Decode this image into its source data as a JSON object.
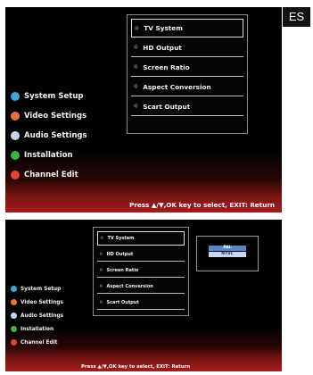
{
  "language_tag": "ES",
  "colors": {
    "system_setup": "#3fa8d8",
    "video_settings": "#e8743a",
    "audio_settings": "#c9d3e8",
    "installation": "#3fb04a",
    "channel_edit": "#e0423a",
    "bottom_band": "#a51c1c",
    "option_highlight": "#5a84c8"
  },
  "main_menu": [
    {
      "label": "System Setup",
      "icon": "blue-dot-icon"
    },
    {
      "label": "Video Settings",
      "icon": "orange-dot-icon"
    },
    {
      "label": "Audio Settings",
      "icon": "white-dot-icon"
    },
    {
      "label": "Installation",
      "icon": "green-dot-icon"
    },
    {
      "label": "Channel Edit",
      "icon": "red-dot-icon"
    }
  ],
  "submenu": [
    {
      "label": "TV System"
    },
    {
      "label": "HD Output"
    },
    {
      "label": "Screen Ratio"
    },
    {
      "label": "Aspect Conversion"
    },
    {
      "label": "Scart Output"
    }
  ],
  "tv_system_options": [
    {
      "label": "PAL"
    },
    {
      "label": "NTSC"
    }
  ],
  "hint": "Press ▲/▼,OK key to select, EXIT: Return"
}
